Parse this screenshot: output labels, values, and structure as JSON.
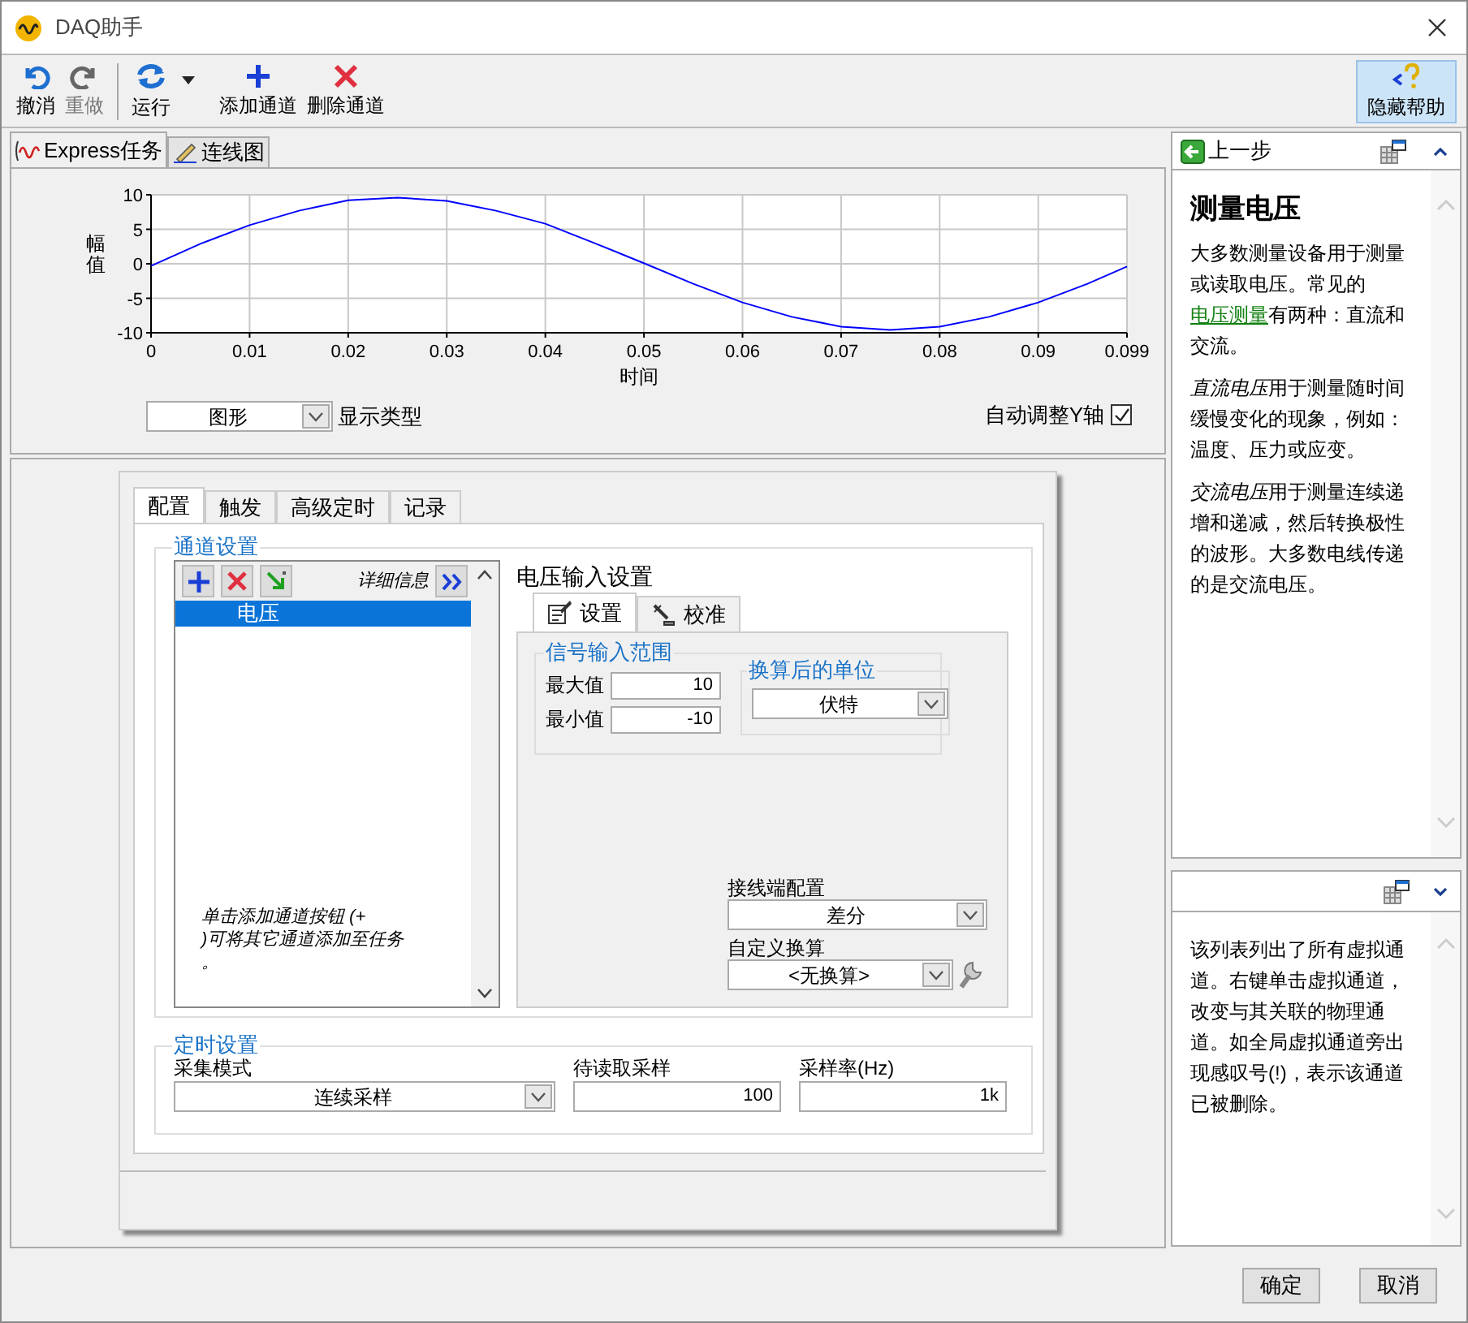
{
  "window": {
    "title": "DAQ助手"
  },
  "toolbar": {
    "buttons": [
      {
        "kind": "undo",
        "label": "撤消",
        "disabled": false
      },
      {
        "kind": "redo",
        "label": "重做",
        "disabled": true
      },
      {
        "kind": "run",
        "label": "运行",
        "disabled": false
      },
      {
        "kind": "add",
        "label": "添加通道",
        "disabled": false
      },
      {
        "kind": "delete",
        "label": "删除通道",
        "disabled": false
      }
    ],
    "help_button": {
      "label": "隐藏帮助",
      "selected": true
    }
  },
  "view_tabs": [
    {
      "label": "Express任务",
      "kind": "task",
      "selected": true
    },
    {
      "label": "连线图",
      "kind": "wiring",
      "selected": false
    }
  ],
  "chart_panel": {
    "chart_data": {
      "type": "line",
      "xlabel": "时间",
      "ylabel": "幅值",
      "xlim": [
        0,
        0.099
      ],
      "ylim": [
        -10,
        10
      ],
      "grid": true,
      "xticks": [
        0,
        0.01,
        0.02,
        0.03,
        0.04,
        0.05,
        0.06,
        0.07,
        0.08,
        0.09,
        0.099
      ],
      "yticks": [
        {
          "value": 10,
          "label": "10"
        },
        {
          "value": 5,
          "label": "5"
        },
        {
          "value": 0,
          "label": "0"
        },
        {
          "value": -5,
          "label": "-5"
        },
        {
          "value": -10,
          "label": "-10"
        }
      ],
      "x": [
        0,
        0.005,
        0.01,
        0.015,
        0.02,
        0.025,
        0.03,
        0.035,
        0.04,
        0.045,
        0.05,
        0.055,
        0.06,
        0.065,
        0.07,
        0.075,
        0.08,
        0.085,
        0.09,
        0.095,
        0.099
      ],
      "series": [
        {
          "color": "#0000ff",
          "values": [
            -0.3,
            2.9,
            5.6,
            7.7,
            9.2,
            9.6,
            9.1,
            7.7,
            5.8,
            3.0,
            0.1,
            -2.9,
            -5.6,
            -7.7,
            -9.1,
            -9.6,
            -9.1,
            -7.7,
            -5.6,
            -2.9,
            -0.4
          ]
        }
      ]
    },
    "display_type": {
      "value": "图形",
      "label": "显示类型"
    },
    "autoscale": {
      "label": "自动调整Y轴",
      "checked": true
    }
  },
  "config": {
    "tabs": [
      {
        "label": "配置",
        "selected": true
      },
      {
        "label": "触发",
        "selected": false
      },
      {
        "label": "高级定时",
        "selected": false
      },
      {
        "label": "记录",
        "selected": false
      }
    ],
    "channel_settings": {
      "title": "通道设置",
      "details_label": "详细信息",
      "channels": [
        {
          "name": "电压",
          "selected": true
        }
      ],
      "hint": [
        "单击添加通道按钮 (+",
        ")可将其它通道添加至任务",
        "。"
      ]
    },
    "voltage_settings": {
      "title": "电压输入设置",
      "tabs": [
        {
          "label": "设置",
          "kind": "settings",
          "selected": true
        },
        {
          "label": "校准",
          "kind": "calibration",
          "selected": false
        }
      ],
      "signal_range": {
        "title": "信号输入范围",
        "max": {
          "label": "最大值",
          "value": "10"
        },
        "min": {
          "label": "最小值",
          "value": "-10"
        }
      },
      "units": {
        "title": "换算后的单位",
        "value": "伏特"
      },
      "terminal_config": {
        "label": "接线端配置",
        "value": "差分"
      },
      "custom_scaling": {
        "label": "自定义换算",
        "value": "<无换算>"
      }
    },
    "timing": {
      "title": "定时设置",
      "mode": {
        "label": "采集模式",
        "value": "连续采样"
      },
      "samples": {
        "label": "待读取采样",
        "value": "100"
      },
      "rate": {
        "label": "采样率(Hz)",
        "value": "1k"
      }
    }
  },
  "help": {
    "back": "上一步",
    "title": "测量电压",
    "paragraphs": [
      [
        {
          "kind": "text",
          "text": "大多数测量设备用于测量或读取电压。常见的"
        },
        {
          "kind": "link",
          "text": "电压测量"
        },
        {
          "kind": "text",
          "text": "有两种：直流和交流。"
        }
      ],
      [
        {
          "kind": "italic",
          "text": "直流电压"
        },
        {
          "kind": "text",
          "text": "用于测量随时间缓慢变化的现象，例如：温度、压力或应变。"
        }
      ],
      [
        {
          "kind": "italic",
          "text": "交流电压"
        },
        {
          "kind": "text",
          "text": "用于测量连续递增和递减，然后转换极性的波形。大多数电线传递的是交流电压。"
        }
      ]
    ],
    "context": "该列表列出了所有虚拟通道。右键单击虚拟通道，改变与其关联的物理通道。如全局虚拟通道旁出现感叹号(!)，表示该通道已被删除。"
  },
  "buttons": [
    "确定",
    "取消"
  ]
}
